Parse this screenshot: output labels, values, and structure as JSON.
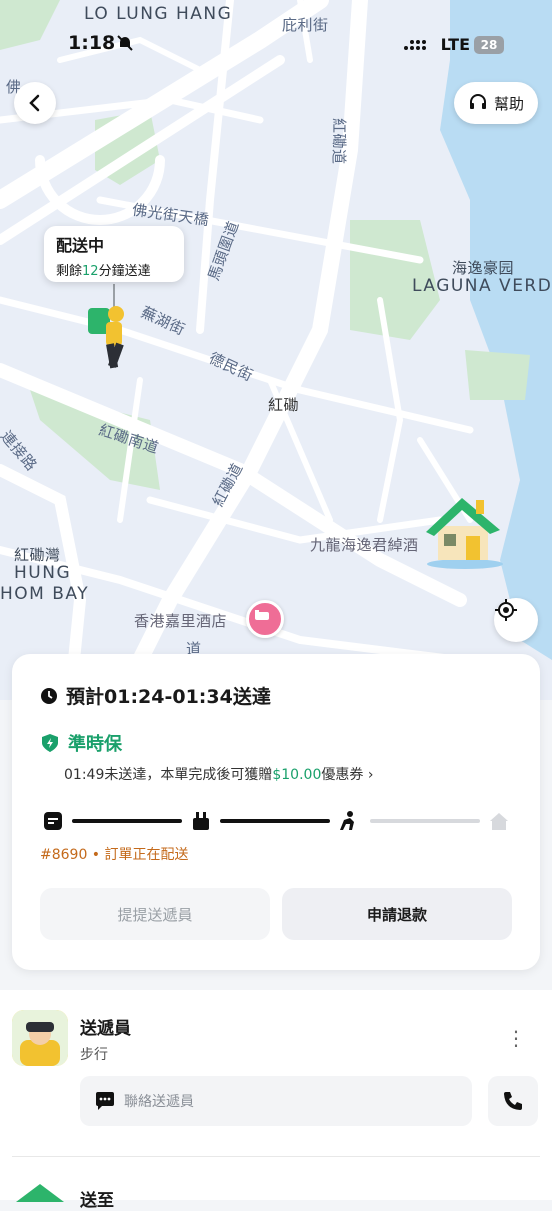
{
  "status_bar": {
    "time": "1:18",
    "network": "LTE",
    "battery": "28"
  },
  "map": {
    "labels": {
      "lo_lung_hang": "LO LUNG HANG",
      "pei_li_street": "庇利街",
      "hung_hom_road": "紅磡道",
      "laguna_zh": "海逸豪园",
      "laguna_en": "LAGUNA VERD",
      "fat_kwong_bridge": "佛光街天橋",
      "ma_tau_wai_road": "馬頭圍道",
      "wu_hu_street": "蕪湖街",
      "tak_man_street": "德民街",
      "hung_hom": "紅磡",
      "hung_hom_south_road": "紅磡南道",
      "hung_hom_road2": "紅磡道",
      "connection_road": "連接路",
      "hung_hom_bay_zh": "紅磡灣",
      "hung_hom_bay_en1": "HUNG",
      "hung_hom_bay_en2": "HOM BAY",
      "harbour_grand": "九龍海逸君綽酒",
      "kerry_hotel": "香港嘉里酒店",
      "road_bottom": "道",
      "fo_partial": "佛",
      "left_road": "道"
    }
  },
  "header": {
    "help_label": "幫助"
  },
  "rider_bubble": {
    "title": "配送中",
    "prefix": "剩餘",
    "minutes": "12",
    "suffix": "分鐘送達"
  },
  "card": {
    "eta": "預計01:24-01:34送達",
    "guarantee_title": "準時保",
    "guarantee_prefix": "01:49未送達，本單完成後可獲贈",
    "guarantee_amount": "$10.00",
    "guarantee_suffix": "優惠券",
    "order_status": "#8690 • 訂單正在配送",
    "progress": {
      "stage": 3,
      "total": 4,
      "active_color": "#111111",
      "inactive_color": "#d7d9dd"
    },
    "buttons": {
      "remind": "提提送遞員",
      "refund": "申請退款"
    }
  },
  "courier": {
    "name": "送遞員",
    "mode": "步行",
    "contact_placeholder": "聯絡送遞員",
    "more": "⋮"
  },
  "destination": {
    "label": "送至"
  },
  "colors": {
    "accent_green": "#1aa06b",
    "status_orange": "#c46a1b"
  }
}
